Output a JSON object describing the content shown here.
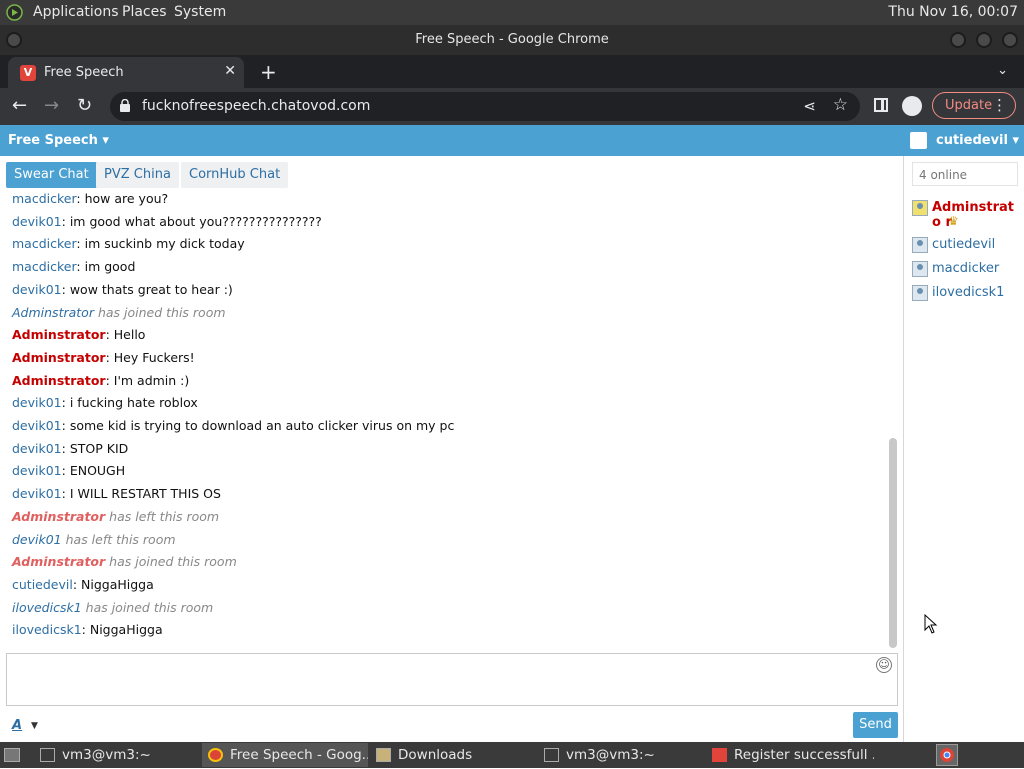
{
  "desktop": {
    "menus": [
      "Applications",
      "Places",
      "System"
    ],
    "clock": "Thu Nov 16, 00:07"
  },
  "window": {
    "title": "Free Speech - Google Chrome"
  },
  "browser": {
    "tab_title": "Free Speech",
    "url": "fucknofreespeech.chatovod.com",
    "update_label": "Update"
  },
  "chat": {
    "room_menu": "Free Speech",
    "current_user": "cutiedevil",
    "room_tabs": [
      "Swear Chat",
      "PVZ China",
      "CornHub Chat"
    ],
    "messages": [
      {
        "type": "msg",
        "nick": "macdicker",
        "admin": false,
        "text": ": how are you?"
      },
      {
        "type": "msg",
        "nick": "devik01",
        "admin": false,
        "text": ": im good what about you???????????????"
      },
      {
        "type": "msg",
        "nick": "macdicker",
        "admin": false,
        "text": ": im suckinb my dick today"
      },
      {
        "type": "msg",
        "nick": "macdicker",
        "admin": false,
        "text": ": im good"
      },
      {
        "type": "msg",
        "nick": "devik01",
        "admin": false,
        "text": ": wow thats great to hear :)"
      },
      {
        "type": "sys",
        "nick": "Adminstrator",
        "admin": false,
        "text": " has joined this room"
      },
      {
        "type": "msg",
        "nick": "Adminstrator",
        "admin": true,
        "text": ": Hello"
      },
      {
        "type": "msg",
        "nick": "Adminstrator",
        "admin": true,
        "text": ": Hey Fuckers!"
      },
      {
        "type": "msg",
        "nick": "Adminstrator",
        "admin": true,
        "text": ": I'm admin :)"
      },
      {
        "type": "msg",
        "nick": "devik01",
        "admin": false,
        "text": ": i fucking hate roblox"
      },
      {
        "type": "msg",
        "nick": "devik01",
        "admin": false,
        "text": ": some kid is trying to download an auto clicker virus on my pc"
      },
      {
        "type": "msg",
        "nick": "devik01",
        "admin": false,
        "text": ": STOP KID"
      },
      {
        "type": "msg",
        "nick": "devik01",
        "admin": false,
        "text": ": ENOUGH"
      },
      {
        "type": "msg",
        "nick": "devik01",
        "admin": false,
        "text": ": I WILL RESTART THIS OS"
      },
      {
        "type": "sys",
        "nick": "Adminstrator",
        "admin": true,
        "text": " has left this room"
      },
      {
        "type": "sys",
        "nick": "devik01",
        "admin": false,
        "text": " has left this room"
      },
      {
        "type": "sys",
        "nick": "Adminstrator",
        "admin": true,
        "text": " has joined this room"
      },
      {
        "type": "msg",
        "nick": "cutiedevil",
        "admin": false,
        "text": ": NiggaHigga"
      },
      {
        "type": "sys",
        "nick": "ilovedicsk1",
        "admin": false,
        "text": " has joined this room"
      },
      {
        "type": "msg",
        "nick": "ilovedicsk1",
        "admin": false,
        "text": ": NiggaHigga"
      }
    ],
    "online_count": "4 online",
    "users": [
      {
        "name": "Adminstrato r",
        "admin": true
      },
      {
        "name": "cutiedevil",
        "admin": false
      },
      {
        "name": "macdicker",
        "admin": false
      },
      {
        "name": "ilovedicsk1",
        "admin": false
      }
    ],
    "font_button": "A",
    "send_label": "Send"
  },
  "taskbar": [
    {
      "label": "vm3@vm3:~",
      "icon": "terminal-icon"
    },
    {
      "label": "Free Speech - Goog...",
      "icon": "chrome-icon"
    },
    {
      "label": "Downloads",
      "icon": "folder-icon"
    },
    {
      "label": "vm3@vm3:~",
      "icon": "terminal-icon"
    },
    {
      "label": "Register successfull ...",
      "icon": "vivaldi-icon"
    }
  ],
  "colors": {
    "accent": "#4ba1d2",
    "admin_nick": "#c40000",
    "nick": "#2d6ea3"
  }
}
